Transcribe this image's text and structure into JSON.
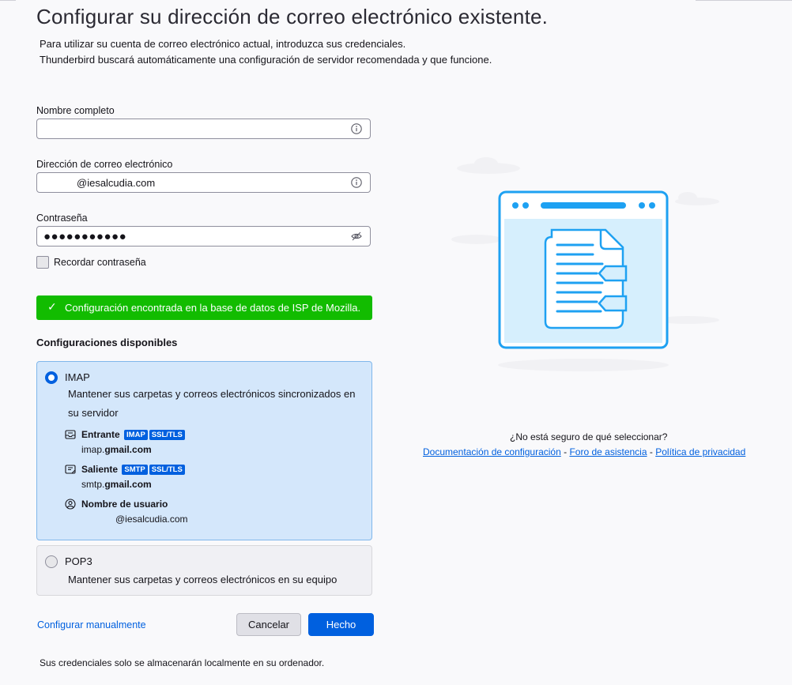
{
  "title": "Configurar su dirección de correo electrónico existente.",
  "intro": {
    "line1": "Para utilizar su cuenta de correo electrónico actual, introduzca sus credenciales.",
    "line2": "Thunderbird buscará automáticamente una configuración de servidor recomendada y que funcione."
  },
  "form": {
    "fullname_label": "Nombre completo",
    "fullname_value": "",
    "email_label": "Dirección de correo electrónico",
    "email_value": "@iesalcudia.com",
    "password_label": "Contraseña",
    "password_value": "●●●●●●●●●●●",
    "remember_label": "Recordar contraseña"
  },
  "status": {
    "message": "Configuración encontrada en la base de datos de ISP de Mozilla.",
    "color": "#12bc00"
  },
  "configs": {
    "title": "Configuraciones disponibles",
    "imap": {
      "name": "IMAP",
      "description": "Mantener sus carpetas y correos electrónicos sincronizados en su servidor",
      "incoming_label": "Entrante",
      "incoming_badges": [
        "IMAP",
        "SSL/TLS"
      ],
      "incoming_host_prefix": "imap.",
      "incoming_host_domain": "gmail.com",
      "outgoing_label": "Saliente",
      "outgoing_badges": [
        "SMTP",
        "SSL/TLS"
      ],
      "outgoing_host_prefix": "smtp.",
      "outgoing_host_domain": "gmail.com",
      "username_label": "Nombre de usuario",
      "username_value": "@iesalcudia.com"
    },
    "pop3": {
      "name": "POP3",
      "description": "Mantener sus carpetas y correos electrónicos en su equipo"
    }
  },
  "actions": {
    "manual": "Configurar manualmente",
    "cancel": "Cancelar",
    "done": "Hecho"
  },
  "footer": "Sus credenciales solo se almacenarán localmente en su ordenador.",
  "help": {
    "question": "¿No está seguro de qué seleccionar?",
    "link1": "Documentación de configuración",
    "sep": "-",
    "link2": "Foro de asistencia",
    "link3": "Política de privacidad"
  },
  "colors": {
    "accent": "#0060df",
    "illustration_blue": "#1ea1f2"
  }
}
